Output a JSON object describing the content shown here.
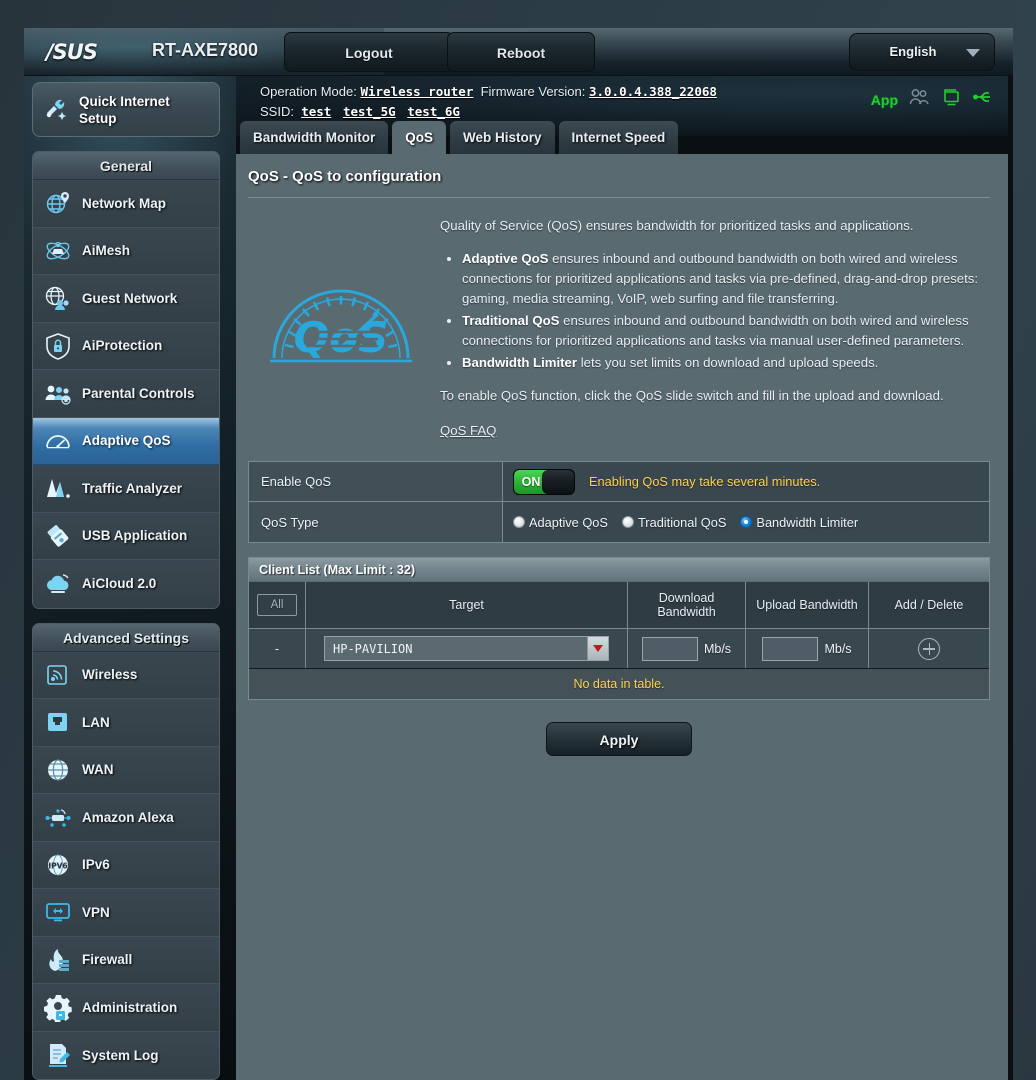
{
  "topbar": {
    "brand": "/SUS",
    "model": "RT-AXE7800",
    "logout_label": "Logout",
    "reboot_label": "Reboot",
    "language": "English"
  },
  "sysinfo": {
    "operation_mode_label": "Operation Mode:",
    "operation_mode_value": "Wireless router",
    "firmware_label": "Firmware Version:",
    "firmware_value": "3.0.0.4.388_22068",
    "ssid_label": "SSID:",
    "ssid_list": [
      "test",
      "test_5G",
      "test_6G"
    ],
    "app_label": "App"
  },
  "sidebar": {
    "quick_setup": "Quick Internet Setup",
    "general_title": "General",
    "general_items": [
      {
        "label": "Network Map",
        "icon": "network-map-icon"
      },
      {
        "label": "AiMesh",
        "icon": "aimesh-icon"
      },
      {
        "label": "Guest Network",
        "icon": "guest-network-icon"
      },
      {
        "label": "AiProtection",
        "icon": "shield-lock-icon"
      },
      {
        "label": "Parental Controls",
        "icon": "parental-controls-icon"
      },
      {
        "label": "Adaptive QoS",
        "icon": "speedometer-icon"
      },
      {
        "label": "Traffic Analyzer",
        "icon": "traffic-analyzer-icon"
      },
      {
        "label": "USB Application",
        "icon": "usb-drive-icon"
      },
      {
        "label": "AiCloud 2.0",
        "icon": "cloud-icon"
      }
    ],
    "active_item": "Adaptive QoS",
    "advanced_title": "Advanced Settings",
    "advanced_items": [
      {
        "label": "Wireless",
        "icon": "wifi-icon"
      },
      {
        "label": "LAN",
        "icon": "lan-port-icon"
      },
      {
        "label": "WAN",
        "icon": "globe-icon"
      },
      {
        "label": "Amazon Alexa",
        "icon": "alexa-icon"
      },
      {
        "label": "IPv6",
        "icon": "ipv6-icon"
      },
      {
        "label": "VPN",
        "icon": "vpn-icon"
      },
      {
        "label": "Firewall",
        "icon": "firewall-icon"
      },
      {
        "label": "Administration",
        "icon": "gear-icon"
      },
      {
        "label": "System Log",
        "icon": "system-log-icon"
      }
    ]
  },
  "tabs": [
    {
      "label": "Bandwidth Monitor",
      "active": false
    },
    {
      "label": "QoS",
      "active": true
    },
    {
      "label": "Web History",
      "active": false
    },
    {
      "label": "Internet Speed",
      "active": false
    }
  ],
  "panel": {
    "title": "QoS - QoS to configuration",
    "intro": "Quality of Service (QoS) ensures bandwidth for prioritized tasks and applications.",
    "bullets": [
      {
        "bold": "Adaptive QoS",
        "rest": " ensures inbound and outbound bandwidth on both wired and wireless connections for prioritized applications and tasks via pre-defined, drag-and-drop presets: gaming, media streaming, VoIP, web surfing and file transferring."
      },
      {
        "bold": "Traditional QoS",
        "rest": " ensures inbound and outbound bandwidth on both wired and wireless connections for prioritized applications and tasks via manual user-defined parameters."
      },
      {
        "bold": "Bandwidth Limiter",
        "rest": " lets you set limits on download and upload speeds."
      }
    ],
    "outro": "To enable QoS function, click the QoS slide switch and fill in the upload and download.",
    "faq_link": "QoS FAQ",
    "logo_text": "QoS"
  },
  "settings": {
    "enable_qos_label": "Enable QoS",
    "enable_qos_state": "ON",
    "enable_qos_note": "Enabling QoS may take several minutes.",
    "qos_type_label": "QoS Type",
    "qos_type_options": [
      {
        "label": "Adaptive QoS",
        "selected": false
      },
      {
        "label": "Traditional QoS",
        "selected": false
      },
      {
        "label": "Bandwidth Limiter",
        "selected": true
      }
    ]
  },
  "client_list": {
    "header": "Client List (Max Limit : 32)",
    "all_button": "All",
    "columns": [
      "Target",
      "Download Bandwidth",
      "Upload Bandwidth",
      "Add / Delete"
    ],
    "row": {
      "index": "-",
      "target": "HP-PAVILION",
      "download_value": "",
      "upload_value": "",
      "unit": "Mb/s"
    },
    "empty_message": "No data in table."
  },
  "apply_label": "Apply",
  "colors": {
    "accent_blue": "#2f6ea4",
    "panel_bg": "#596a71",
    "toggle_green": "#2aae34",
    "warn_yellow": "#ffd24d",
    "radio_selected": "#1a87e0",
    "icon_cyan": "#4cc3ef"
  }
}
